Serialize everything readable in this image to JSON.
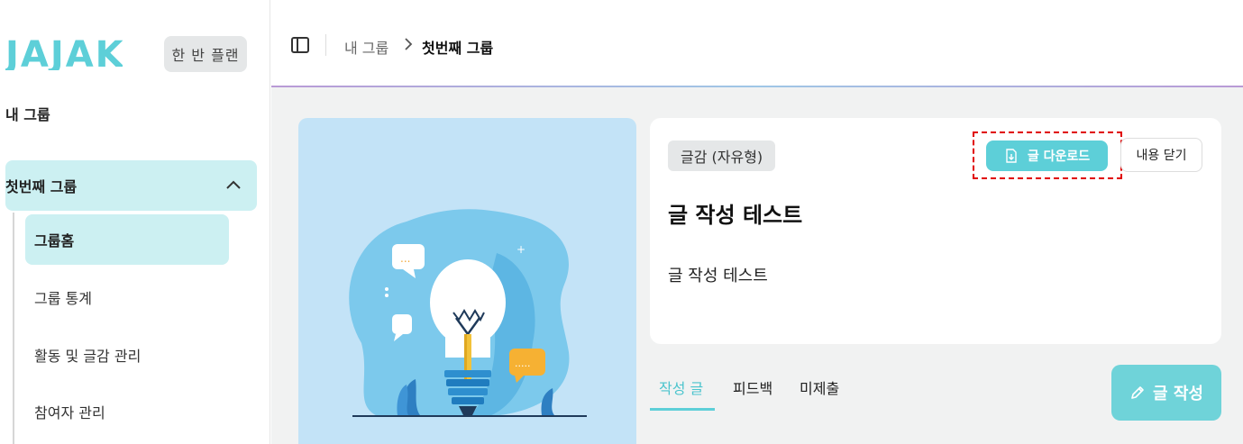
{
  "sidebar": {
    "logo_text": "JAJAK",
    "plan_badge": "한 반 플랜",
    "section_title": "내 그룹",
    "group": {
      "label": "첫번째 그룹",
      "items": [
        {
          "label": "그룹홈",
          "active": true
        },
        {
          "label": "그룹 통계"
        },
        {
          "label": "활동 및 글감 관리"
        },
        {
          "label": "참여자 관리"
        }
      ]
    }
  },
  "header": {
    "breadcrumb": [
      "내 그룹",
      "첫번째 그룹"
    ]
  },
  "card": {
    "tag": "글감 (자유형)",
    "download_label": "글 다운로드",
    "close_label": "내용 닫기",
    "title": "글 작성 테스트",
    "body": "글 작성 테스트"
  },
  "tabs": [
    {
      "label": "작성 글",
      "active": true
    },
    {
      "label": "피드백"
    },
    {
      "label": "미제출"
    }
  ],
  "write_button": "글 작성",
  "colors": {
    "accent": "#5dcfd8",
    "active_bg": "#ccf0f2",
    "logo": "#5dcfd8",
    "highlight_dash": "#e00000"
  }
}
